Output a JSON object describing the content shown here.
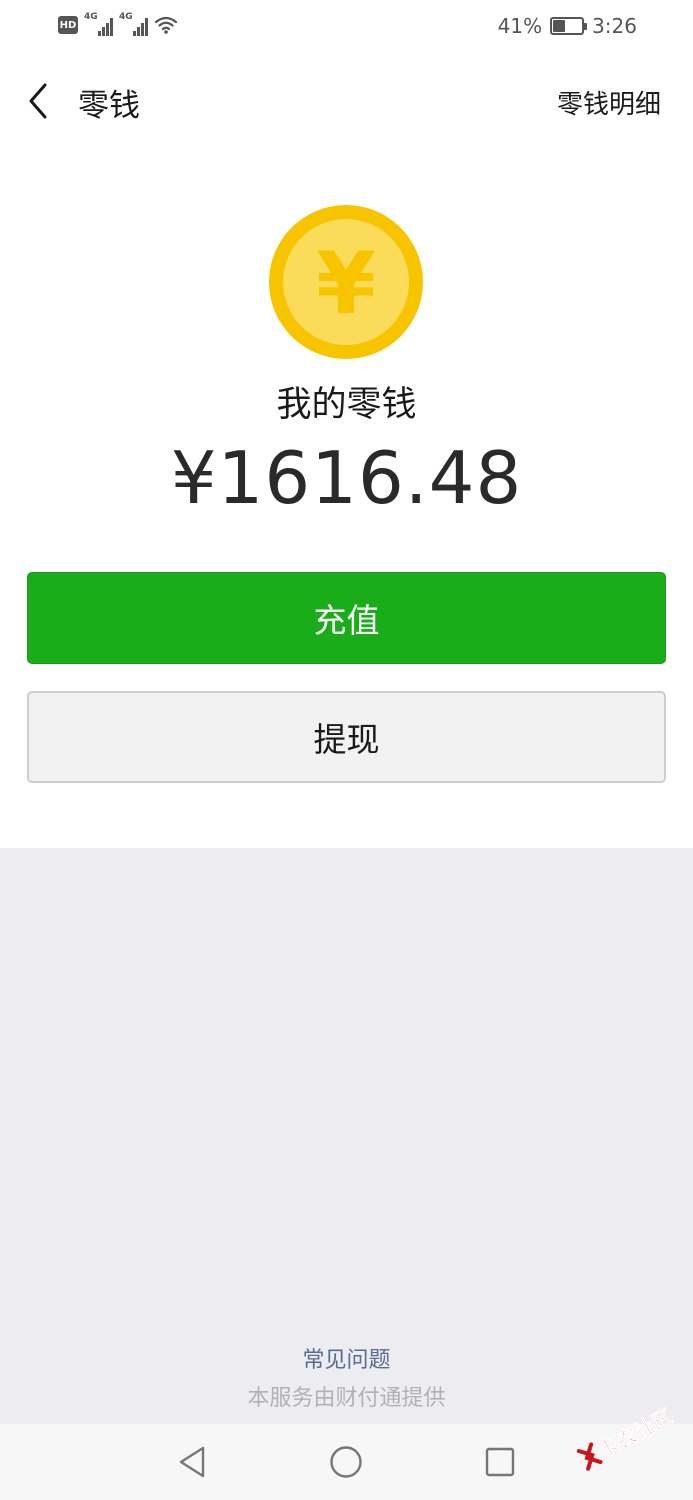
{
  "status_bar": {
    "hd": "HD",
    "signal_1": "4G",
    "signal_2": "4G",
    "battery_pct": "41%",
    "battery_level": 0.41,
    "time": "3:26"
  },
  "nav": {
    "title": "零钱",
    "detail_link": "零钱明细"
  },
  "wallet": {
    "coin_symbol": "¥",
    "label": "我的零钱",
    "amount": "¥1616.48"
  },
  "actions": {
    "recharge": "充值",
    "withdraw": "提现"
  },
  "footer": {
    "faq": "常见问题",
    "provider": "本服务由财付通提供"
  },
  "watermark": {
    "text": "卡农社区"
  },
  "colors": {
    "primary_green": "#1aad19",
    "coin_outer": "#f8c400",
    "coin_inner": "#fadc5a",
    "link_blue": "#576b95",
    "gray_bg": "#ededf1"
  }
}
